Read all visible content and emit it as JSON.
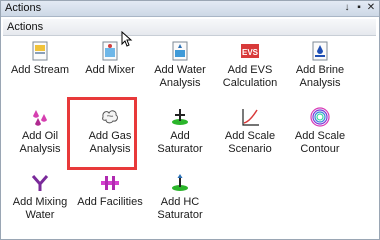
{
  "window": {
    "title": "Actions",
    "header": "Actions"
  },
  "titlebar_buttons": [
    {
      "icon": "pin-icon",
      "glyph": "↓"
    },
    {
      "icon": "dock-icon",
      "glyph": "▪"
    },
    {
      "icon": "close-icon",
      "glyph": "✕"
    }
  ],
  "actions": [
    {
      "line1": "Add Stream",
      "line2": "",
      "icon": "stream-icon"
    },
    {
      "line1": "Add Mixer",
      "line2": "",
      "icon": "mixer-icon"
    },
    {
      "line1": "Add Water",
      "line2": "Analysis",
      "icon": "water-analysis-icon"
    },
    {
      "line1": "Add EVS",
      "line2": "Calculation",
      "icon": "evs-icon",
      "icon_text": "EVS"
    },
    {
      "line1": "Add Brine",
      "line2": "Analysis",
      "icon": "brine-analysis-icon"
    },
    {
      "line1": "Add Oil",
      "line2": "Analysis",
      "icon": "oil-analysis-icon"
    },
    {
      "line1": "Add Gas",
      "line2": "Analysis",
      "icon": "gas-analysis-icon"
    },
    {
      "line1": "Add",
      "line2": "Saturator",
      "icon": "saturator-icon"
    },
    {
      "line1": "Add Scale",
      "line2": "Scenario",
      "icon": "scale-scenario-icon"
    },
    {
      "line1": "Add Scale",
      "line2": "Contour",
      "icon": "scale-contour-icon"
    },
    {
      "line1": "Add Mixing",
      "line2": "Water",
      "icon": "mixing-water-icon"
    },
    {
      "line1": "Add Facilities",
      "line2": "",
      "icon": "facilities-icon"
    },
    {
      "line1": "Add HC",
      "line2": "Saturator",
      "icon": "hc-saturator-icon"
    }
  ],
  "colors": {
    "highlight": "#e8393a",
    "titlebar": "#cdd8e6"
  }
}
